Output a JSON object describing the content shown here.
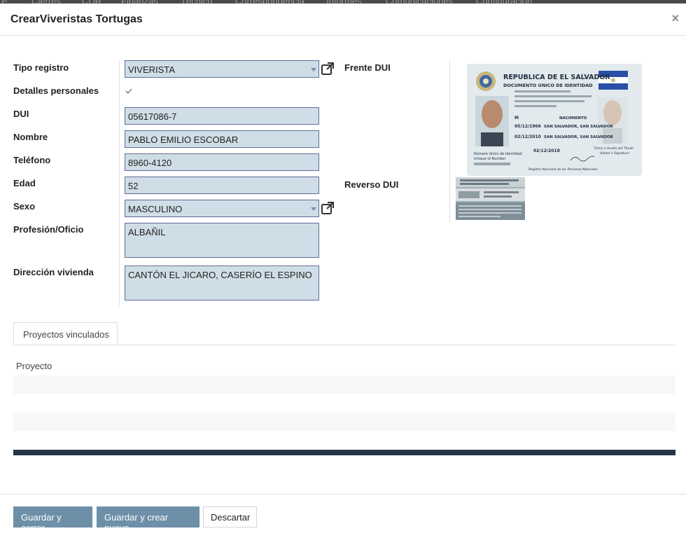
{
  "background_nav": {
    "items": [
      "P",
      "Cierres",
      "CDR",
      "Finanzas",
      "Técnico",
      "Correspondencia",
      "Informes",
      "Comunicaciones",
      "Configuración"
    ]
  },
  "modal": {
    "title": "CrearViveristas Tortugas",
    "close_glyph": "×"
  },
  "form": {
    "tipo_registro": {
      "label": "Tipo registro",
      "value": "VIVERISTA"
    },
    "detalles_personales": {
      "label": "Detalles personales",
      "checked": true
    },
    "dui": {
      "label": "DUI",
      "value": "05617086-7"
    },
    "nombre": {
      "label": "Nombre",
      "value": "PABLO EMILIO ESCOBAR"
    },
    "telefono": {
      "label": "Teléfono",
      "value": "8960-4120"
    },
    "edad": {
      "label": "Edad",
      "value": "52"
    },
    "sexo": {
      "label": "Sexo",
      "value": "MASCULINO"
    },
    "profesion": {
      "label": "Profesión/Oficio",
      "value": "ALBAÑIL"
    },
    "direccion": {
      "label": "Dirección vivienda",
      "value": "CANTÓN EL JICARO, CASERÍO EL ESPINO"
    },
    "frente_dui": {
      "label": "Frente DUI",
      "card_title": "REPUBLICA DE EL SALVADOR",
      "card_subtitle": "DOCUMENTO UNICO DE IDENTIDAD",
      "sex": "M",
      "nacimiento_label": "NACIMIENTO",
      "birth_date": "05/12/1966",
      "birth_place": "SAN SALVADOR, SAN SALVADOR",
      "issue_date": "02/12/2010",
      "issue_place": "SAN SALVADOR, SAN SALVADOR",
      "expiry_date": "02/12/2018",
      "id_number_label": "Número Único de Identidad",
      "id_number_label_en": "Unique Id Number",
      "signature_label": "Firma o Huella del Titular",
      "signature_label_en": "Holder's Signature",
      "registry_label": "Registro Nacional de las Personas Naturales"
    },
    "reverso_dui": {
      "label": "Reverso DUI"
    }
  },
  "tabs": [
    {
      "label": "Proyectos vinculados"
    }
  ],
  "table": {
    "column_header": "Proyecto"
  },
  "footer": {
    "save_close": "Guardar y cerrar",
    "save_new": "Guardar y crear nuevo",
    "discard": "Descartar"
  },
  "colors": {
    "primary_button": "#6d8fa8",
    "field_background": "#cfdde6",
    "field_border": "#5f6d9a",
    "dark_bar": "#263646"
  },
  "icons": [
    "external-link-icon",
    "check-icon",
    "chevron-down-icon",
    "close-icon"
  ]
}
